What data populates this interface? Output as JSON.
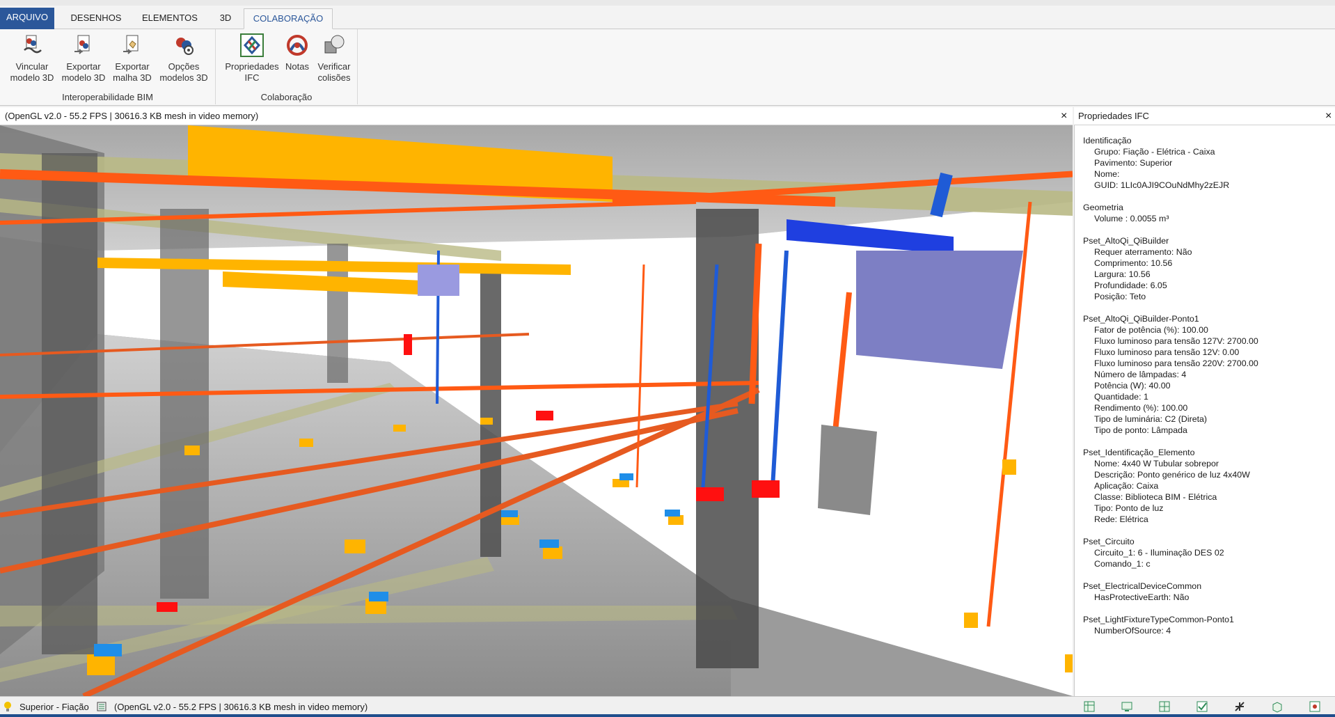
{
  "tabs": [
    {
      "label": "ARQUIVO"
    },
    {
      "label": "DESENHOS"
    },
    {
      "label": "ELEMENTOS"
    },
    {
      "label": "3D"
    },
    {
      "label": "COLABORAÇÃO"
    }
  ],
  "ribbon": {
    "interop": {
      "label": "Interoperabilidade BIM",
      "buttons": [
        {
          "line1": "Vincular",
          "line2": "modelo 3D"
        },
        {
          "line1": "Exportar",
          "line2": "modelo 3D"
        },
        {
          "line1": "Exportar",
          "line2": "malha 3D"
        },
        {
          "line1": "Opções",
          "line2": "modelos 3D"
        }
      ]
    },
    "colab": {
      "label": "Colaboração",
      "buttons": [
        {
          "line1": "Propriedades",
          "line2": "IFC"
        },
        {
          "line1": "Notas",
          "line2": ""
        },
        {
          "line1": "Verificar",
          "line2": "colisões"
        }
      ]
    }
  },
  "viewport": {
    "title": "(OpenGL v2.0 - 55.2 FPS | 30616.3 KB mesh in video memory)",
    "close": "×"
  },
  "properties_panel": {
    "title": "Propriedades IFC",
    "close": "×",
    "sections": [
      {
        "title": "Identificação",
        "props": [
          "Grupo: Fiação - Elétrica - Caixa",
          "Pavimento: Superior",
          "Nome:",
          "GUID: 1LIc0AJI9COuNdMhy2zEJR"
        ]
      },
      {
        "title": "Geometria",
        "props": [
          "Volume : 0.0055 m³"
        ]
      },
      {
        "title": "Pset_AltoQi_QiBuilder",
        "props": [
          "Requer aterramento: Não",
          "Comprimento: 10.56",
          "Largura: 10.56",
          "Profundidade: 6.05",
          "Posição: Teto"
        ]
      },
      {
        "title": "Pset_AltoQi_QiBuilder-Ponto1",
        "props": [
          "Fator de potência (%): 100.00",
          "Fluxo luminoso para tensão 127V: 2700.00",
          "Fluxo luminoso para tensão 12V: 0.00",
          "Fluxo luminoso para tensão 220V: 2700.00",
          "Número de lâmpadas: 4",
          "Potência (W): 40.00",
          "Quantidade: 1",
          "Rendimento (%): 100.00",
          "Tipo de luminária: C2 (Direta)",
          "Tipo de ponto: Lâmpada"
        ]
      },
      {
        "title": "Pset_Identificação_Elemento",
        "props": [
          "Nome: 4x40 W Tubular sobrepor",
          "Descrição: Ponto genérico de luz 4x40W",
          "Aplicação: Caixa",
          "Classe: Biblioteca BIM - Elétrica",
          "Tipo: Ponto de luz",
          "Rede: Elétrica"
        ]
      },
      {
        "title": "Pset_Circuito",
        "props": [
          "Circuito_1: 6 - Iluminação DES 02",
          "Comando_1: c"
        ]
      },
      {
        "title": "Pset_ElectricalDeviceCommon",
        "props": [
          "HasProtectiveEarth: Não"
        ]
      },
      {
        "title": "Pset_LightFixtureTypeCommon-Ponto1",
        "props": [
          "NumberOfSource: 4"
        ]
      }
    ]
  },
  "statusbar": {
    "floor": "Superior - Fiação",
    "render_info": "(OpenGL v2.0 - 55.2 FPS | 30616.3 KB mesh in video memory)"
  },
  "colors": {
    "ribbon_accent": "#2b579a",
    "conduit_orange": "#ff5a14",
    "tray_yellow": "#ffb400",
    "pipe_blue": "#1f5bd6",
    "box_purple": "#7d7fc4"
  }
}
